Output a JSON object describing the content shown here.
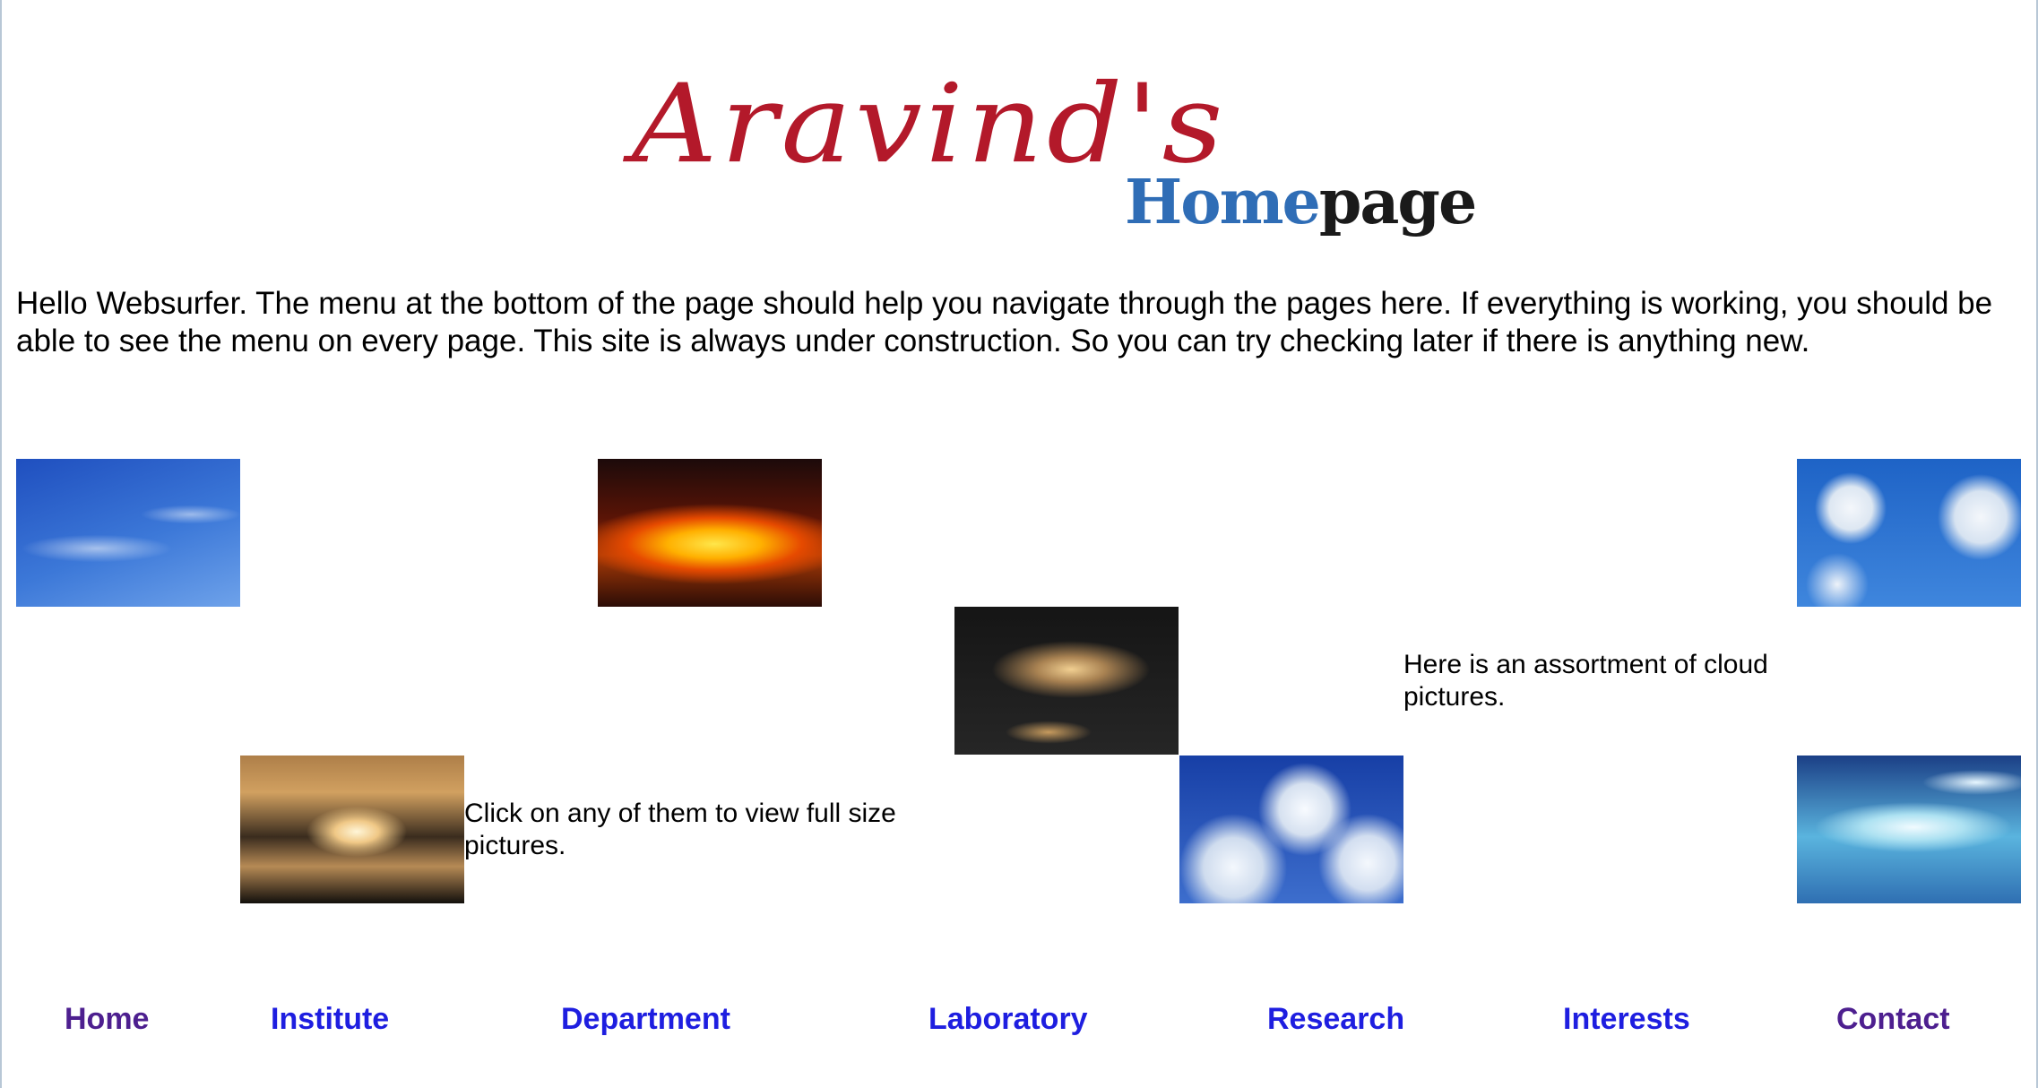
{
  "logo": {
    "main": "Aravind's",
    "sub_a": "Home",
    "sub_b": "page"
  },
  "intro": "Hello Websurfer. The menu at the bottom of the page should help you navigate through the pages here. If everything is working, you should be able to see the menu on every page. This site is always under construction. So you can try checking later if there is anything new.",
  "captions": {
    "assortment": "Here is an assortment of cloud pictures.",
    "click": "Click on any of them to view full size pictures."
  },
  "menu": {
    "home": "Home",
    "institute": "Institute",
    "department": "Department",
    "laboratory": "Laboratory",
    "research": "Research",
    "interests": "Interests",
    "contact": "Contact"
  },
  "colors": {
    "logo_red": "#b3192a",
    "logo_blue": "#2f6db6",
    "link": "#1e1ee0",
    "visited_link": "#4d1f8f"
  }
}
